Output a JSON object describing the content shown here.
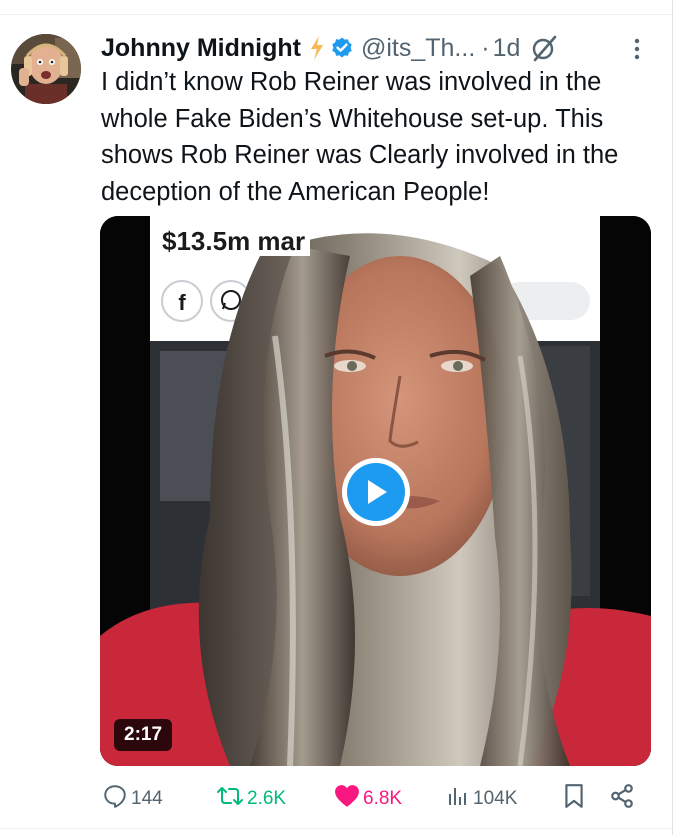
{
  "author": {
    "name": "Johnny Midnight",
    "handle": "@its_Th...",
    "dot": "·",
    "time": "1d"
  },
  "tweet": {
    "text": "I didn’t know Rob Reiner was involved in the whole Fake Biden’s Whitehouse set-up. This shows Rob Reiner was Clearly involved in the deception of the American People!"
  },
  "media": {
    "headline": "$13.5m mar",
    "duration": "2:17",
    "share_icons": [
      "facebook-icon",
      "whatsapp-icon"
    ]
  },
  "actions": {
    "replies": "144",
    "reposts": "2.6K",
    "likes": "6.8K",
    "views": "104K"
  },
  "icons": [
    "lightning-bolt-icon",
    "verified-badge-icon",
    "grok-slash-icon",
    "more-options-icon",
    "reply-icon",
    "repost-icon",
    "heart-icon",
    "views-icon",
    "bookmark-icon",
    "share-icon",
    "play-icon"
  ],
  "colors": {
    "text": "#0f1419",
    "muted": "#536471",
    "accent": "#1d9bf0",
    "repost": "#00ba7c",
    "like": "#f91880",
    "bolt": "#f5b955"
  }
}
